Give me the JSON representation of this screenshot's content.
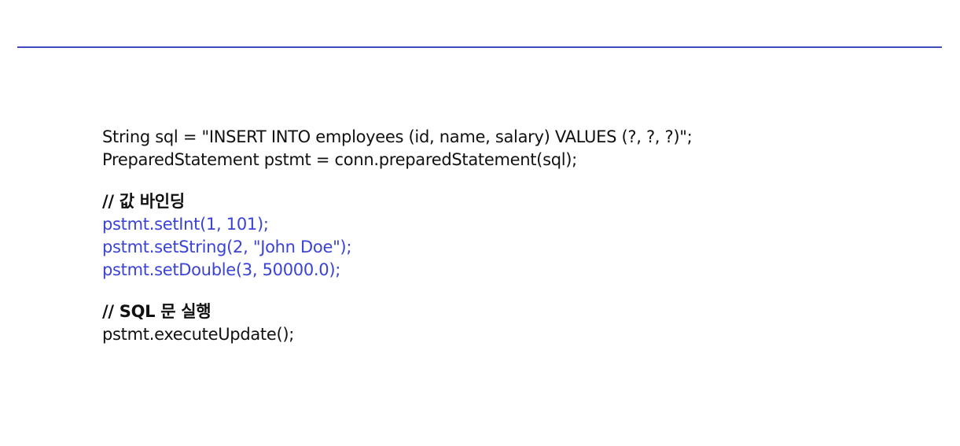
{
  "colors": {
    "rule": "#3f4bbf",
    "code_text": "#111111",
    "highlight_text": "#3a43d6",
    "background": "#ffffff"
  },
  "code": {
    "line_sql": "String sql = \"INSERT INTO employees (id, name, salary) VALUES (?, ?, ?)\";",
    "line_prepare": "PreparedStatement pstmt = conn.preparedStatement(sql);",
    "comment_binding": "// 값 바인딩",
    "line_set_int": "pstmt.setInt(1, 101);",
    "line_set_string": "pstmt.setString(2, \"John Doe\");",
    "line_set_double": "pstmt.setDouble(3, 50000.0);",
    "comment_execute": "// SQL 문 실행",
    "line_execute": "pstmt.executeUpdate();"
  }
}
